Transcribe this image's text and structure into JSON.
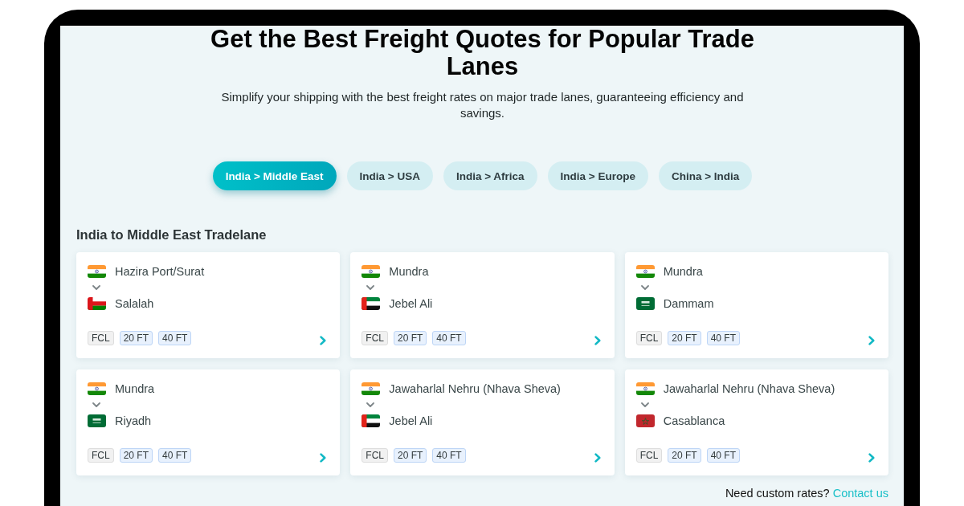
{
  "heading": {
    "title": "Get the Best Freight Quotes for Popular Trade Lanes",
    "subtitle": "Simplify your shipping with the best freight rates on major trade lanes, guaranteeing efficiency and savings."
  },
  "tabs": [
    {
      "label": "India > Middle East",
      "selected": true
    },
    {
      "label": "India > USA",
      "selected": false
    },
    {
      "label": "India > Africa",
      "selected": false
    },
    {
      "label": "India > Europe",
      "selected": false
    },
    {
      "label": "China > India",
      "selected": false
    }
  ],
  "section_title": "India to Middle East Tradelane",
  "lanes": [
    {
      "origin": {
        "port": "Hazira Port/Surat",
        "kind": "india"
      },
      "destination": {
        "port": "Salalah",
        "kind": "oman"
      },
      "tags": [
        {
          "label": "FCL",
          "kind": "mode"
        },
        {
          "label": "20 FT",
          "kind": "container"
        },
        {
          "label": "40 FT",
          "kind": "container"
        }
      ]
    },
    {
      "origin": {
        "port": "Mundra",
        "kind": "india"
      },
      "destination": {
        "port": "Jebel Ali",
        "kind": "uae"
      },
      "tags": [
        {
          "label": "FCL",
          "kind": "mode"
        },
        {
          "label": "20 FT",
          "kind": "container"
        },
        {
          "label": "40 FT",
          "kind": "container"
        }
      ]
    },
    {
      "origin": {
        "port": "Mundra",
        "kind": "india"
      },
      "destination": {
        "port": "Dammam",
        "kind": "saudi"
      },
      "tags": [
        {
          "label": "FCL",
          "kind": "mode"
        },
        {
          "label": "20 FT",
          "kind": "container"
        },
        {
          "label": "40 FT",
          "kind": "container"
        }
      ]
    },
    {
      "origin": {
        "port": "Mundra",
        "kind": "india"
      },
      "destination": {
        "port": "Riyadh",
        "kind": "saudi"
      },
      "tags": [
        {
          "label": "FCL",
          "kind": "mode"
        },
        {
          "label": "20 FT",
          "kind": "container"
        },
        {
          "label": "40 FT",
          "kind": "container"
        }
      ]
    },
    {
      "origin": {
        "port": "Jawaharlal Nehru (Nhava Sheva)",
        "kind": "india"
      },
      "destination": {
        "port": "Jebel Ali",
        "kind": "uae"
      },
      "tags": [
        {
          "label": "FCL",
          "kind": "mode"
        },
        {
          "label": "20 FT",
          "kind": "container"
        },
        {
          "label": "40 FT",
          "kind": "container"
        }
      ]
    },
    {
      "origin": {
        "port": "Jawaharlal Nehru (Nhava Sheva)",
        "kind": "india"
      },
      "destination": {
        "port": "Casablanca",
        "kind": "morocco"
      },
      "tags": [
        {
          "label": "FCL",
          "kind": "mode"
        },
        {
          "label": "20 FT",
          "kind": "container"
        },
        {
          "label": "40 FT",
          "kind": "container"
        }
      ]
    }
  ],
  "footer": {
    "text": "Need custom rates?",
    "link": "Contact us"
  }
}
